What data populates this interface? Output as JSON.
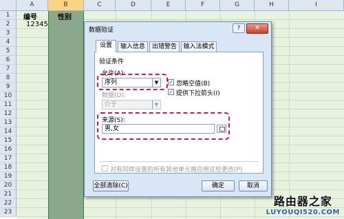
{
  "spreadsheet": {
    "columns": [
      "A",
      "B",
      "C",
      "D",
      "E",
      "F",
      "G",
      "H",
      "I"
    ],
    "selected_column": "B",
    "rows": [
      "1",
      "2",
      "3",
      "4",
      "5",
      "6",
      "7",
      "8",
      "9",
      "10",
      "11",
      "12",
      "13",
      "14",
      "15",
      "16",
      "17",
      "18",
      "19",
      "20",
      "21",
      "22",
      "23"
    ],
    "cells": {
      "A1": "编号",
      "B1": "性别",
      "A2": "12345"
    }
  },
  "dialog": {
    "title": "数据验证",
    "help_label": "?",
    "close_label": "✕",
    "tabs": [
      "设置",
      "输入信息",
      "出错警告",
      "输入法模式"
    ],
    "active_tab": "设置",
    "section_title": "验证条件",
    "allow_label": "允许(A):",
    "allow_value": "序列",
    "ignore_blank_label": "忽略空值(B)",
    "ignore_blank_checked": true,
    "dropdown_label": "提供下拉箭头(I)",
    "dropdown_checked": true,
    "data_label": "数据(D):",
    "data_value": "介于",
    "source_label": "来源(S):",
    "source_value": "男,女",
    "apply_all_label": "对有同样设置的所有其他单元格应用这些更改(P)",
    "apply_all_checked": false,
    "clear_all_label": "全部清除(C)",
    "ok_label": "确定",
    "cancel_label": "取消"
  },
  "watermark": {
    "main": "路由器之家",
    "sub": "LUYOUQI520.COM"
  },
  "colors": {
    "highlight": "#d4145a",
    "selected_column": "#8ca88c",
    "grid_bg": "#e7f3df"
  }
}
